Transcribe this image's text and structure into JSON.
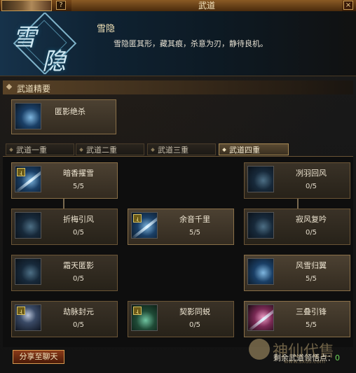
{
  "window": {
    "title": "武道",
    "help_label": "?",
    "close_label": "×"
  },
  "header": {
    "emblem_chars": [
      "雪",
      "隐"
    ],
    "skill_name": "雪隐",
    "skill_desc": "雪隐匿其形，藏其痕，杀意为刃，静待良机。"
  },
  "section": {
    "title": "武道精要"
  },
  "ultimate": {
    "label": "匿影绝杀",
    "icon": "ghost-blade-icon"
  },
  "tabs": [
    {
      "label": "武道一重",
      "active": false
    },
    {
      "label": "武道二重",
      "active": false
    },
    {
      "label": "武道三重",
      "active": false
    },
    {
      "label": "武道四重",
      "active": true
    }
  ],
  "skills": [
    {
      "label": "暗香擢雪",
      "count": "5/5",
      "icon": "snow-blade-icon"
    },
    {
      "label": "冽羽回风",
      "count": "0/5",
      "icon": "feather-wind-icon"
    },
    {
      "label": "折梅引风",
      "count": "0/5",
      "icon": "plum-wind-icon"
    },
    {
      "label": "余音千里",
      "count": "5/5",
      "icon": "echo-slash-icon"
    },
    {
      "label": "寂风复吟",
      "count": "0/5",
      "icon": "silent-wind-icon"
    },
    {
      "label": "霜天匿影",
      "count": "0/5",
      "icon": "frost-shadow-icon"
    },
    {
      "label": "风雪归翼",
      "count": "5/5",
      "icon": "snow-wing-icon"
    },
    {
      "label": "劫脉封元",
      "count": "0/5",
      "icon": "seal-figure-icon"
    },
    {
      "label": "契影同蜕",
      "count": "0/5",
      "icon": "shadow-shed-icon"
    },
    {
      "label": "三叠引锋",
      "count": "5/5",
      "icon": "triple-edge-icon"
    }
  ],
  "footer": {
    "share_label": "分享至聊天",
    "remaining_label": "剩余武道领悟点：",
    "remaining_value": "0"
  },
  "watermark": {
    "text": "神仙代售",
    "url": "www.sxds.com"
  }
}
